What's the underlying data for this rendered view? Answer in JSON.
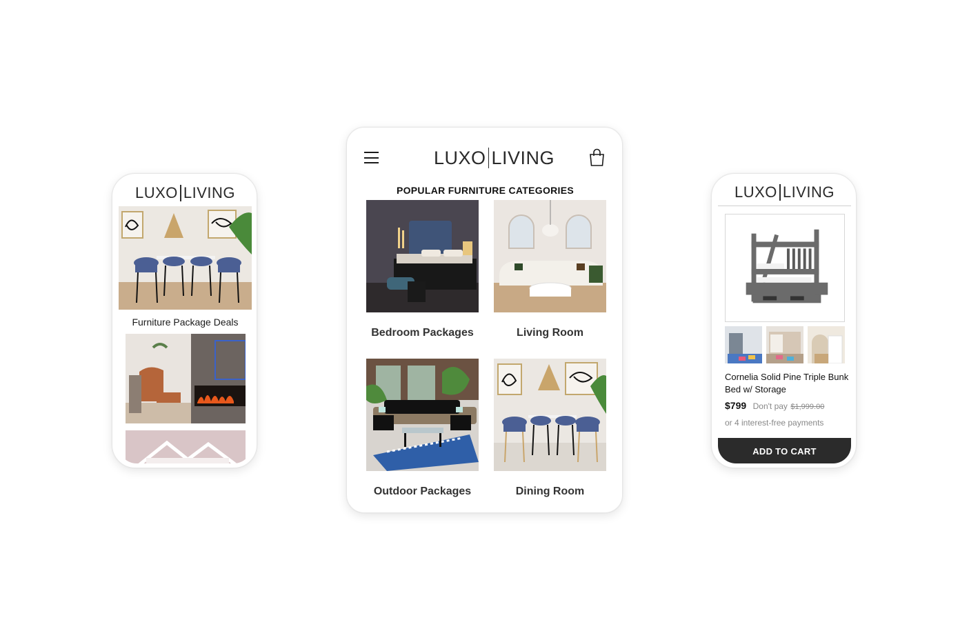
{
  "brand": {
    "logo_left": "LUXO",
    "logo_right": "LIVING",
    "logo_color": "#2a2a2a"
  },
  "left_phone": {
    "section_title": "Furniture Package Deals",
    "images": [
      "dining-room-image",
      "living-room-fireplace-image",
      "kids-bedroom-image"
    ]
  },
  "tablet": {
    "menu_icon": "hamburger-menu-icon",
    "cart_icon": "shopping-bag-icon",
    "heading": "POPULAR FURNITURE CATEGORIES",
    "categories": [
      {
        "label": "Bedroom Packages",
        "image": "bedroom-image"
      },
      {
        "label": "Living Room",
        "image": "living-room-image"
      },
      {
        "label": "Outdoor Packages",
        "image": "outdoor-image"
      },
      {
        "label": "Dining Room",
        "image": "dining-room-image"
      }
    ]
  },
  "right_phone": {
    "product_name": "Cornelia Solid Pine Triple Bunk Bed w/ Storage",
    "price": "$799",
    "dont_pay": "Don't pay",
    "original_price": "$1,999.00",
    "installments": "or 4 interest-free payments",
    "add_to_cart": "ADD TO CART",
    "thumbnails": [
      "bunk-bed-thumb-1",
      "bunk-bed-thumb-2",
      "bunk-bed-thumb-3"
    ],
    "button_color": "#2b2b2b"
  }
}
